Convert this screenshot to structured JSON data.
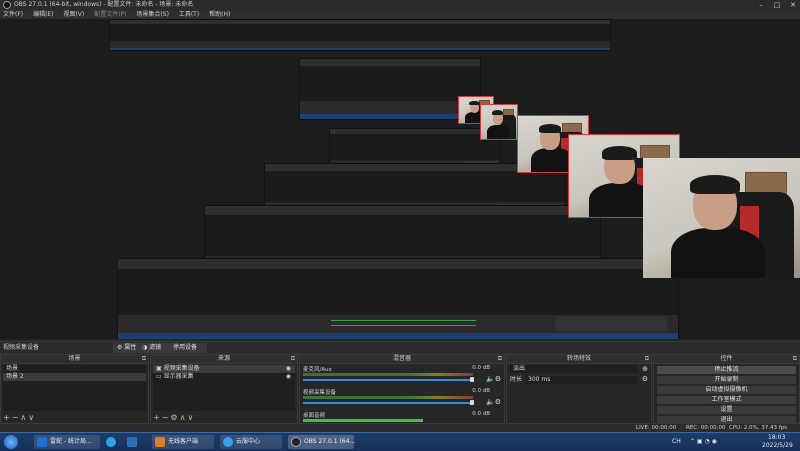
{
  "window": {
    "title": "OBS 27.0.1 (64-bit, windows) - 配置文件: 未命名 - 场景: 未命名",
    "controls": [
      "–",
      "□",
      "✕"
    ]
  },
  "menu": [
    "文件(F)",
    "编辑(E)",
    "视图(V)",
    "配置文件(P)",
    "场景集合(S)",
    "工具(T)",
    "帮助(H)"
  ],
  "source_toolbar": {
    "selected_source": "视频采集设备",
    "properties_label": "属性",
    "filters_label": "滤镜",
    "deactivate_label": "停用设备"
  },
  "scenes": {
    "title": "场景",
    "items": [
      "场景",
      "场景 2"
    ]
  },
  "sources": {
    "title": "来源",
    "items": [
      "视频采集设备",
      "显示器采集"
    ]
  },
  "mixer": {
    "title": "混音器",
    "channels": [
      {
        "name": "麦克风/Aux",
        "db": "0.0 dB"
      },
      {
        "name": "视频采集设备",
        "db": "0.0 dB"
      },
      {
        "name": "桌面音频",
        "db": "0.0 dB"
      }
    ]
  },
  "transitions": {
    "title": "转场特效",
    "type": "淡出",
    "duration_label": "时长",
    "duration_value": "300 ms"
  },
  "controls": {
    "title": "控件",
    "buttons": [
      "停止推流",
      "开始录制",
      "启动虚拟摄像机",
      "工作室模式",
      "设置",
      "退出"
    ]
  },
  "status": {
    "live": "LIVE: 00:00:00",
    "rec": "REC: 00:00:00",
    "cpu": "CPU: 2.0%, 37.43 fps"
  },
  "taskbar": {
    "apps": [
      {
        "label": "雷蛇 - 统计局...",
        "color": "#1f6fd0"
      },
      {
        "label": "",
        "color": "#2aa3e8"
      },
      {
        "label": "",
        "color": "#2b6fb8"
      },
      {
        "label": "无线客户端",
        "color": "#e07b26"
      },
      {
        "label": "云服中心",
        "color": "#3b9ee8"
      },
      {
        "label": "OBS 27.0.1 (64...",
        "color": "#222222"
      }
    ],
    "lang": "CH",
    "time": "18:03",
    "date": "2022/5/29"
  },
  "icons": {
    "start": "windows-start-icon",
    "gear": "gear-icon",
    "speaker": "speaker-icon"
  }
}
